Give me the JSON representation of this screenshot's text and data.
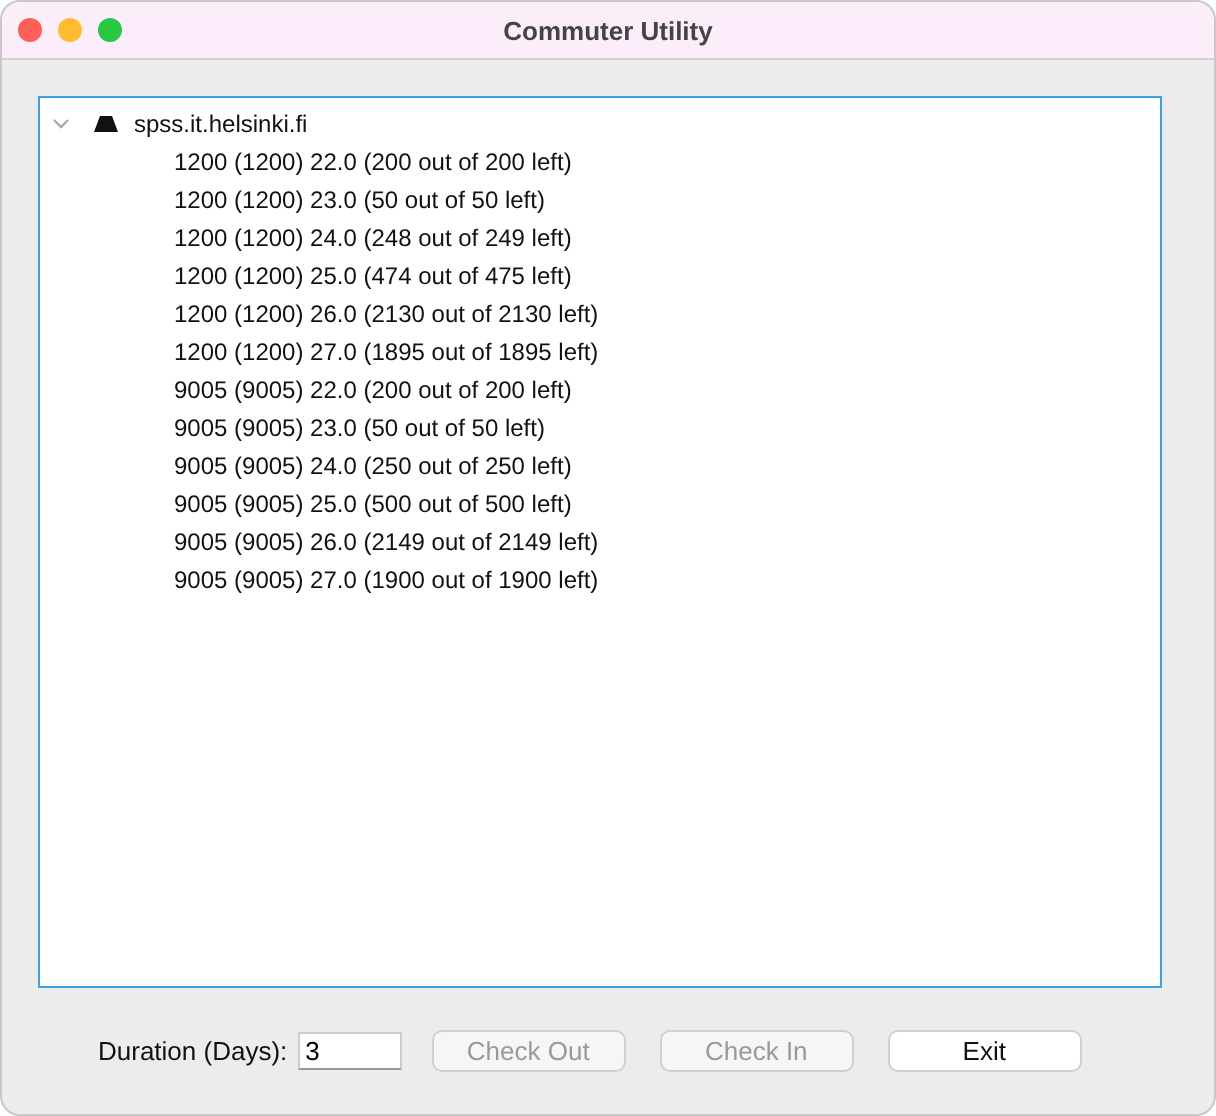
{
  "window": {
    "title": "Commuter Utility"
  },
  "tree": {
    "label": "spss.it.helsinki.fi",
    "expanded": true,
    "children": [
      {
        "label": "1200 (1200) 22.0 (200 out of 200 left)"
      },
      {
        "label": "1200 (1200) 23.0 (50 out of 50 left)"
      },
      {
        "label": "1200 (1200) 24.0 (248 out of 249 left)"
      },
      {
        "label": "1200 (1200) 25.0 (474 out of 475 left)"
      },
      {
        "label": "1200 (1200) 26.0 (2130 out of 2130 left)"
      },
      {
        "label": "1200 (1200) 27.0 (1895 out of 1895 left)"
      },
      {
        "label": "9005 (9005) 22.0 (200 out of 200 left)"
      },
      {
        "label": "9005 (9005) 23.0 (50 out of 50 left)"
      },
      {
        "label": "9005 (9005) 24.0 (250 out of 250 left)"
      },
      {
        "label": "9005 (9005) 25.0 (500 out of 500 left)"
      },
      {
        "label": "9005 (9005) 26.0 (2149 out of 2149 left)"
      },
      {
        "label": "9005 (9005) 27.0 (1900 out of 1900 left)"
      }
    ]
  },
  "duration": {
    "label": "Duration (Days):",
    "value": "3"
  },
  "buttons": [
    {
      "label": "Check Out",
      "disabled": true
    },
    {
      "label": "Check In",
      "disabled": true
    },
    {
      "label": "Exit",
      "disabled": false
    }
  ]
}
